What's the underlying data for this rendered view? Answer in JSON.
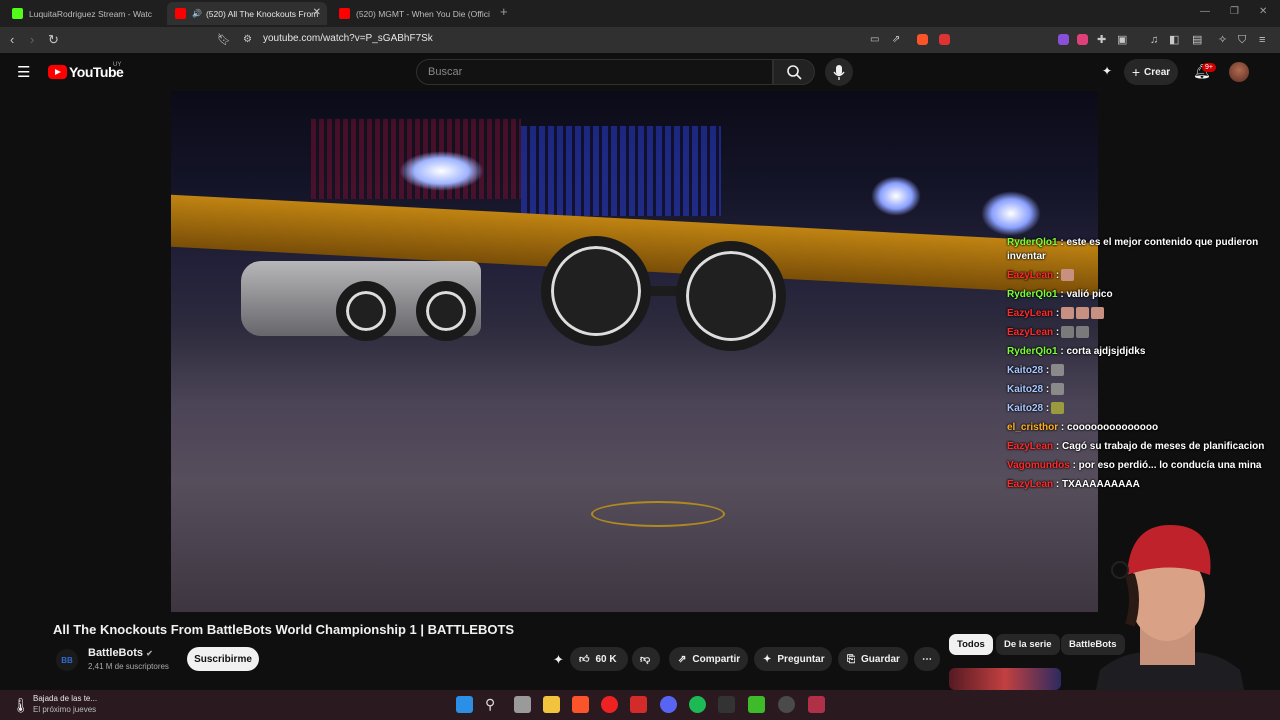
{
  "tabs": [
    {
      "title": "LuquitaRodriguez Stream - Watc",
      "active": false,
      "icon": "kick-icon",
      "color": "#53fc18"
    },
    {
      "title": "(520) All The Knockouts From",
      "active": true,
      "icon": "youtube-icon",
      "color": "#ff0000"
    },
    {
      "title": "(520) MGMT - When You Die (Offici",
      "active": false,
      "icon": "youtube-icon",
      "color": "#ff0000"
    }
  ],
  "browser": {
    "url": "youtube.com/watch?v=P_sGABhF7Sk"
  },
  "youtube": {
    "logo_text": "YouTube",
    "country_code": "UY",
    "search_placeholder": "Buscar",
    "create_label": "Crear",
    "notification_count": "9+"
  },
  "chat": [
    {
      "user": "RyderQlo1",
      "color": "#7cff3a",
      "text": ": este es el mejor contenido que pudieron inventar",
      "emotes": []
    },
    {
      "user": "EazyLean",
      "color": "#ff2b2b",
      "text": ":",
      "emotes": [
        "#c89080"
      ]
    },
    {
      "user": "RyderQlo1",
      "color": "#7cff3a",
      "text": ": valió pico",
      "emotes": []
    },
    {
      "user": "EazyLean",
      "color": "#ff2b2b",
      "text": ":",
      "emotes": [
        "#c89080",
        "#c89080",
        "#c89080"
      ]
    },
    {
      "user": "EazyLean",
      "color": "#ff2b2b",
      "text": ":",
      "emotes": [
        "#7a7a7a",
        "#7a7a7a"
      ]
    },
    {
      "user": "RyderQlo1",
      "color": "#7cff3a",
      "text": ": corta ajdjsjdjdks",
      "emotes": []
    },
    {
      "user": "Kaito28",
      "color": "#a9c8ff",
      "text": ":",
      "emotes": [
        "#8a8a8a"
      ]
    },
    {
      "user": "Kaito28",
      "color": "#a9c8ff",
      "text": ":",
      "emotes": [
        "#8a8a8a"
      ]
    },
    {
      "user": "Kaito28",
      "color": "#a9c8ff",
      "text": ":",
      "emotes": [
        "#9a9a40"
      ]
    },
    {
      "user": "el_cristhor",
      "color": "#ffb020",
      "text": ": coooooooooooooo",
      "emotes": []
    },
    {
      "user": "EazyLean",
      "color": "#ff2b2b",
      "text": ": Cagó su trabajo de meses de planificacion",
      "emotes": []
    },
    {
      "user": "Vagomundos",
      "color": "#ff2b2b",
      "text": ": por eso perdió... lo conducía una mina",
      "emotes": []
    },
    {
      "user": "EazyLean",
      "color": "#ff2b2b",
      "text": ": TXAAAAAAAAA",
      "emotes": []
    }
  ],
  "video": {
    "title": "All The Knockouts From BattleBots World Championship 1 | BATTLEBOTS",
    "channel": "BattleBots",
    "subscribers": "2,41 M de suscriptores",
    "subscribe_label": "Suscribirme",
    "likes": "60 K",
    "share_label": "Compartir",
    "ask_label": "Preguntar",
    "save_label": "Guardar",
    "channel_badge": "BB"
  },
  "chips": [
    {
      "label": "Todos",
      "active": true
    },
    {
      "label": "De la serie",
      "active": false
    },
    {
      "label": "BattleBots",
      "active": false
    }
  ],
  "taskbar": {
    "weather_title": "Bajada de las te...",
    "weather_sub": "El próximo jueves"
  }
}
